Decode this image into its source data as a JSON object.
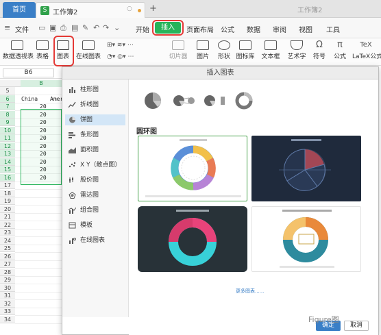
{
  "titlebar": {
    "home_tab": "首页",
    "doc_tab": "工作簿2",
    "doc_icon": "S",
    "window_title": "工作簿2",
    "add_tab": "+"
  },
  "menubar": {
    "file": "文件",
    "tabs": [
      "开始",
      "插入",
      "页面布局",
      "公式",
      "数据",
      "审阅",
      "视图",
      "工具"
    ],
    "active_tab": "插入"
  },
  "ribbon": {
    "items": [
      "数据透视表",
      "表格",
      "图表",
      "在线图表",
      "切片器",
      "图片",
      "形状",
      "图标库",
      "文本框",
      "艺术字",
      "符号",
      "公式",
      "LaTeX公式"
    ]
  },
  "formula": {
    "name_box": "B6"
  },
  "sheet": {
    "col_b": "B",
    "rows": [
      "5",
      "6",
      "7",
      "8",
      "9",
      "10",
      "11",
      "12",
      "13",
      "14",
      "15",
      "16",
      "17",
      "18",
      "19",
      "20",
      "21",
      "22",
      "23",
      "24",
      "25",
      "26",
      "27",
      "28",
      "29",
      "30",
      "31",
      "32",
      "33",
      "34"
    ],
    "header_a": "China",
    "header_b": "Amer",
    "values": [
      "20",
      "20",
      "20",
      "20",
      "20",
      "20",
      "20",
      "20",
      "20",
      "20"
    ]
  },
  "dialog": {
    "title": "插入图表",
    "categories": [
      "柱形图",
      "折线图",
      "饼图",
      "条形图",
      "面积图",
      "X Y（散点图）",
      "股价图",
      "雷达图",
      "组合图",
      "模板",
      "在线图表"
    ],
    "active_category": "饼图",
    "section_title": "圆环图",
    "more": "更多图表......",
    "ok": "确定",
    "cancel": "取消"
  },
  "watermark": "Figure图",
  "colors": {
    "accent_green": "#27b45a",
    "accent_blue": "#3a7fc7",
    "highlight_red": "#e53935"
  }
}
